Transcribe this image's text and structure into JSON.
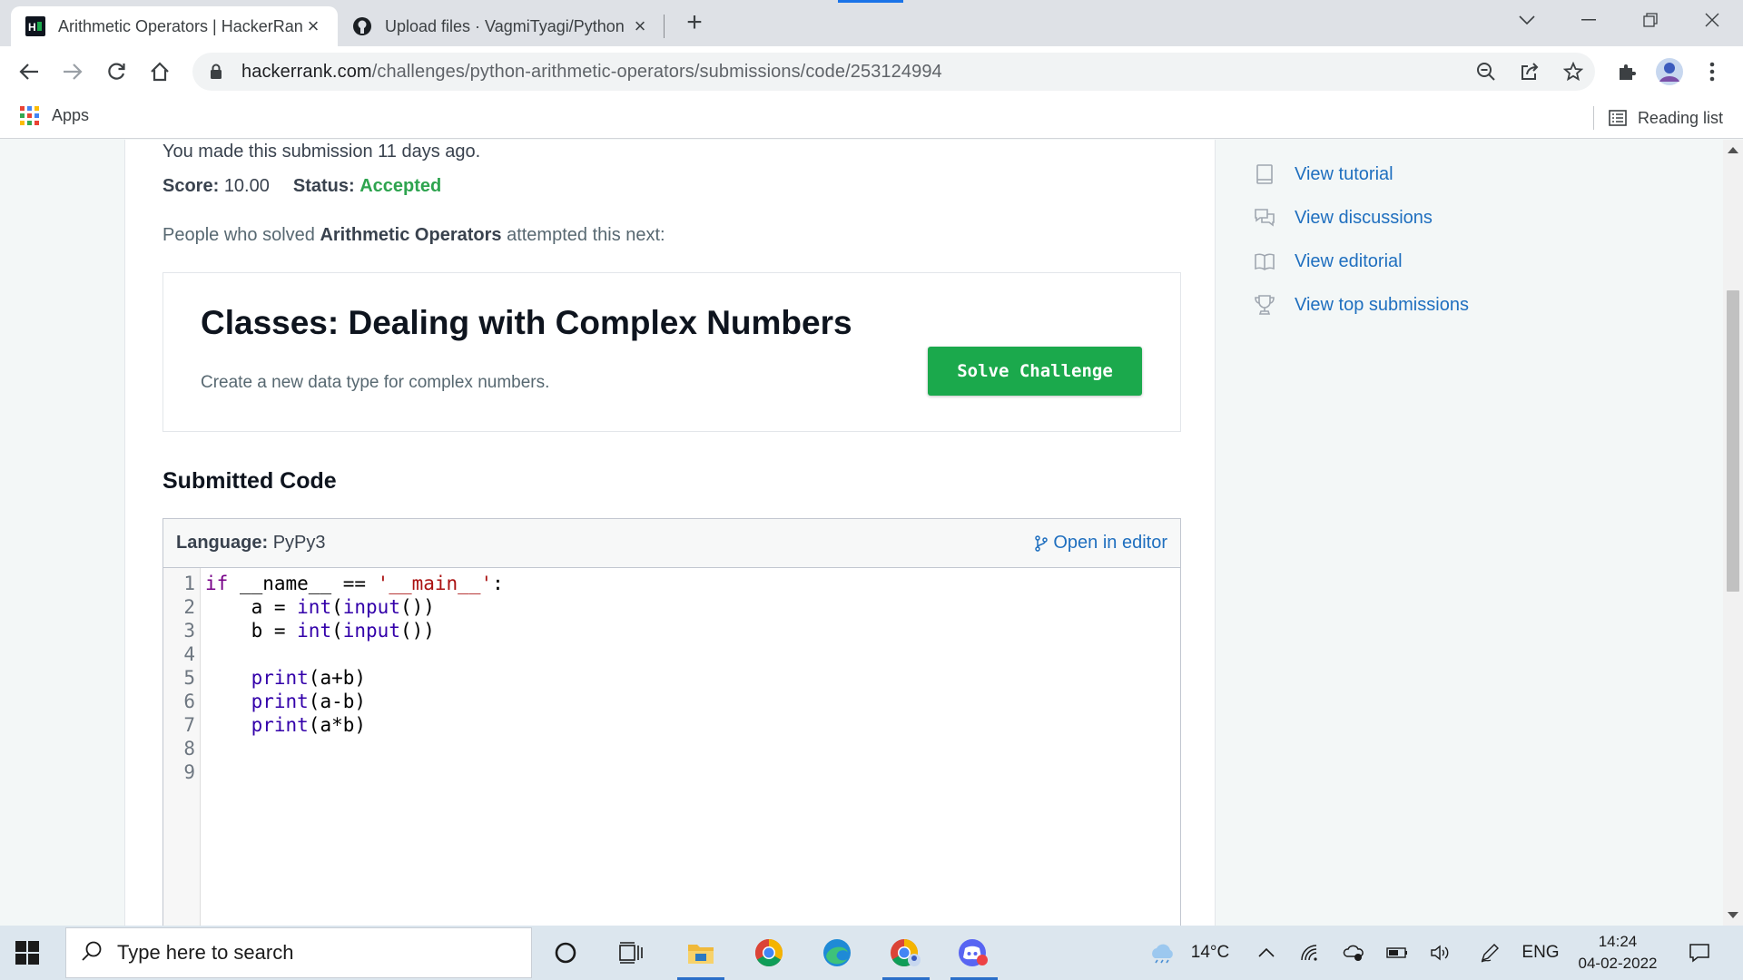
{
  "browser": {
    "tabs": [
      {
        "title": "Arithmetic Operators | HackerRank",
        "active": true
      },
      {
        "title": "Upload files · VagmiTyagi/Python",
        "active": false
      }
    ],
    "url_host": "hackerrank.com",
    "url_path": "/challenges/python-arithmetic-operators/submissions/code/253124994",
    "bookmarks": {
      "apps_label": "Apps",
      "reading_list_label": "Reading list"
    }
  },
  "submission": {
    "made_text": "You made this submission 11 days ago.",
    "score_label": "Score:",
    "score_value": "10.00",
    "status_label": "Status:",
    "status_value": "Accepted",
    "people_prefix": "People who solved ",
    "people_challenge": "Arithmetic Operators",
    "people_suffix": " attempted this next:"
  },
  "next_challenge": {
    "title": "Classes: Dealing with Complex Numbers",
    "description": "Create a new data type for complex numbers.",
    "button_label": "Solve Challenge"
  },
  "code_section": {
    "title": "Submitted Code",
    "language_label": "Language:",
    "language_value": "PyPy3",
    "open_editor_label": "Open in editor",
    "line_numbers": [
      "1",
      "2",
      "3",
      "4",
      "5",
      "6",
      "7",
      "8",
      "9"
    ]
  },
  "sidebar": {
    "items": [
      {
        "label": "View tutorial",
        "icon": "tutorial-icon"
      },
      {
        "label": "View discussions",
        "icon": "discussions-icon"
      },
      {
        "label": "View editorial",
        "icon": "editorial-icon"
      },
      {
        "label": "View top submissions",
        "icon": "trophy-icon"
      }
    ]
  },
  "taskbar": {
    "search_placeholder": "Type here to search",
    "temperature": "14°C",
    "language": "ENG",
    "time": "14:24",
    "date": "04-02-2022"
  },
  "colors": {
    "accent_green": "#1ba94c",
    "status_green": "#2ea44f",
    "link_blue": "#1f6fbf"
  }
}
